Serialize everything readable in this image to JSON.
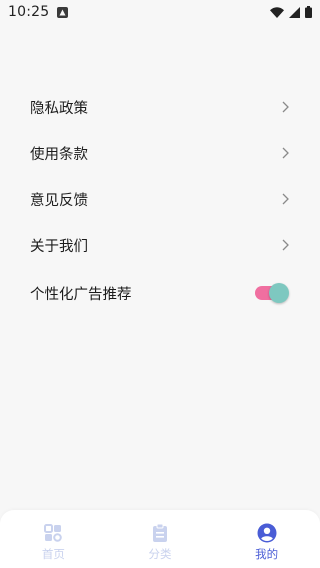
{
  "status_bar": {
    "time": "10:25"
  },
  "menu": {
    "items": [
      {
        "label": "隐私政策"
      },
      {
        "label": "使用条款"
      },
      {
        "label": "意见反馈"
      },
      {
        "label": "关于我们"
      }
    ],
    "toggle_item": {
      "label": "个性化广告推荐",
      "enabled": true
    }
  },
  "tab_bar": {
    "tabs": [
      {
        "label": "首页",
        "icon": "home-grid-icon",
        "active": false
      },
      {
        "label": "分类",
        "icon": "clipboard-icon",
        "active": false
      },
      {
        "label": "我的",
        "icon": "user-icon",
        "active": true
      }
    ]
  },
  "colors": {
    "accent": "#4a5dd6",
    "inactive_tab": "#c9d2ee",
    "toggle_track": "#f06fa0",
    "toggle_knob": "#7ec8c0",
    "background": "#f7f7f7"
  }
}
